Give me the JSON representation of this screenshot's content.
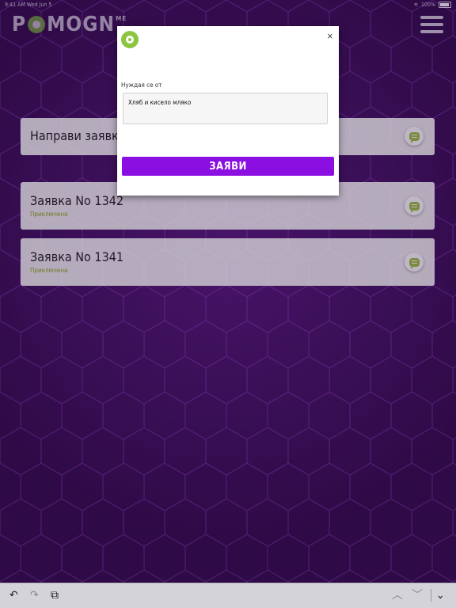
{
  "status_bar": {
    "time": "9:41 AM",
    "date": "Wed Jun 5",
    "battery": "100%"
  },
  "header": {
    "logo_text_1": "P",
    "logo_text_2": "MOGN",
    "logo_badge": "ME",
    "menu_icon": "hamburger-icon"
  },
  "cards": [
    {
      "title": "Направи заявка",
      "status": ""
    },
    {
      "title": "Заявка No 1342",
      "status": "Приключена"
    },
    {
      "title": "Заявка No 1341",
      "status": "Приключена"
    }
  ],
  "modal": {
    "logo_icon": "pomogni-logo-icon",
    "close_label": "×",
    "field_label": "Нуждая се от",
    "field_value": "Хляб и кисело мляко",
    "submit_label": "ЗАЯВИ"
  },
  "toolbar": {
    "undo_icon": "↶",
    "redo_icon": "↷",
    "paste_icon": "⧉",
    "prev_icon": "︿",
    "next_icon": "﹀",
    "dismiss_icon": "⌄"
  },
  "colors": {
    "background": "#2e0a46",
    "accent_purple": "#8a0fe0",
    "accent_green": "#8cc541",
    "status_green": "#7a9a10"
  }
}
